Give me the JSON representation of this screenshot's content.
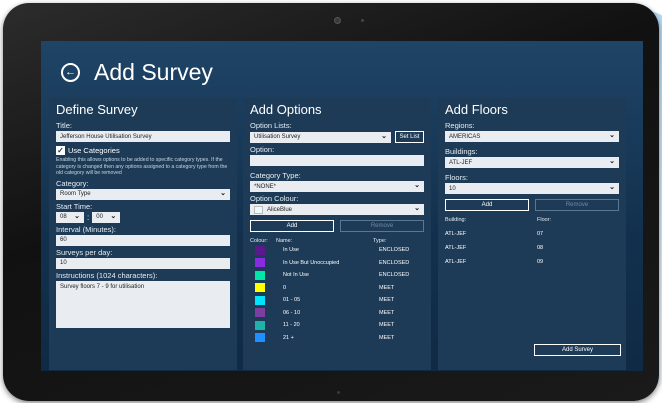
{
  "header": {
    "title": "Add Survey"
  },
  "define": {
    "heading": "Define Survey",
    "title_label": "Title:",
    "title_value": "Jefferson House Utilisation Survey",
    "use_categories_label": "Use Categories",
    "help_text": "Enabling this allows options to be added to specific category types. If the category is changed then any options assigned to a category type from the old category will be removed",
    "category_label": "Category:",
    "category_value": "Room Type",
    "start_time_label": "Start Time:",
    "start_hour": "08",
    "start_minute": "00",
    "interval_label": "Interval (Minutes):",
    "interval_value": "60",
    "surveys_label": "Surveys per day:",
    "surveys_value": "10",
    "instructions_label": "Instructions (1024 characters):",
    "instructions_value": "Survey floors 7 - 9 for utilisation"
  },
  "options": {
    "heading": "Add Options",
    "option_lists_label": "Option Lists:",
    "option_lists_value": "Utilisation Survey",
    "set_list_label": "Set List",
    "option_label": "Option:",
    "option_value": "",
    "category_type_label": "Category Type:",
    "category_type_value": "*NONE*",
    "colour_label": "Option Colour:",
    "colour_value": "AliceBlue",
    "colour_swatch": "#f0f8ff",
    "add_label": "Add",
    "remove_label": "Remove",
    "col_colour": "Colour:",
    "col_name": "Name:",
    "col_type": "Type:",
    "rows": [
      {
        "color": "#5a1a8c",
        "name": "In Use",
        "type": "ENCLOSED"
      },
      {
        "color": "#8a2be2",
        "name": "In Use But Unoccupied",
        "type": "ENCLOSED"
      },
      {
        "color": "#00e6a8",
        "name": "Not In Use",
        "type": "ENCLOSED"
      },
      {
        "color": "#ffff00",
        "name": "0",
        "type": "MEET"
      },
      {
        "color": "#00e5ff",
        "name": "01 - 05",
        "type": "MEET"
      },
      {
        "color": "#7b3fa0",
        "name": "06 - 10",
        "type": "MEET"
      },
      {
        "color": "#20b2aa",
        "name": "11 - 20",
        "type": "MEET"
      },
      {
        "color": "#1e90ff",
        "name": "21 +",
        "type": "MEET"
      }
    ]
  },
  "floors": {
    "heading": "Add Floors",
    "regions_label": "Regions:",
    "regions_value": "AMERICAS",
    "buildings_label": "Buildings:",
    "buildings_value": "ATL-JEF",
    "floors_label": "Floors:",
    "floors_value": "10",
    "add_label": "Add",
    "remove_label": "Remove",
    "col_building": "Building:",
    "col_floor": "Floor:",
    "rows": [
      {
        "building": "ATL-JEF",
        "floor": "07"
      },
      {
        "building": "ATL-JEF",
        "floor": "08"
      },
      {
        "building": "ATL-JEF",
        "floor": "09"
      }
    ],
    "add_survey_label": "Add Survey"
  }
}
